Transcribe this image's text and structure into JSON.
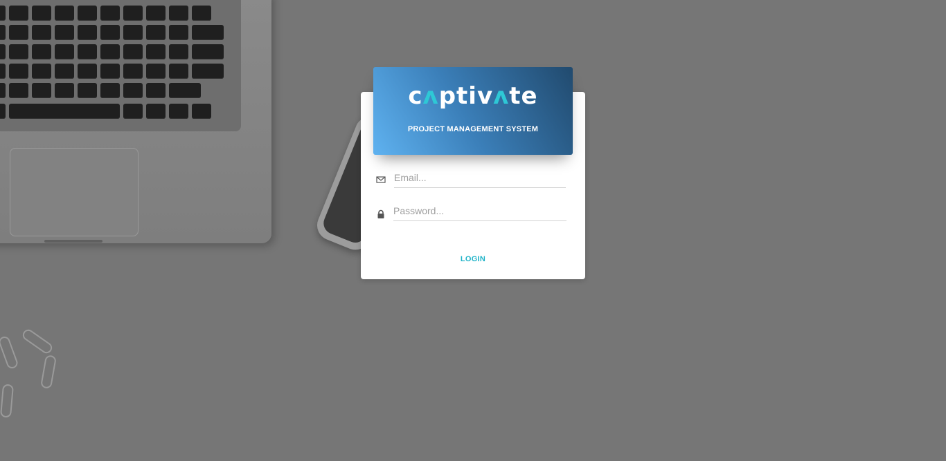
{
  "brand": {
    "logo_text_part1": "c",
    "logo_text_a": "ʌ",
    "logo_text_part2": "ptiv",
    "logo_text_a2": "ʌ",
    "logo_text_part3": "te",
    "subtitle": "PROJECT MANAGEMENT SYSTEM",
    "accent_color": "#2ec8d6"
  },
  "form": {
    "email_placeholder": "Email...",
    "email_value": "",
    "email_icon": "envelope-icon",
    "password_placeholder": "Password...",
    "password_value": "",
    "password_icon": "lock-icon",
    "login_label": "LOGIN",
    "login_color": "#1fb3c8"
  },
  "colors": {
    "background": "#767676",
    "header_gradient_start": "#5fb2f0",
    "header_gradient_end": "#214a6e"
  }
}
